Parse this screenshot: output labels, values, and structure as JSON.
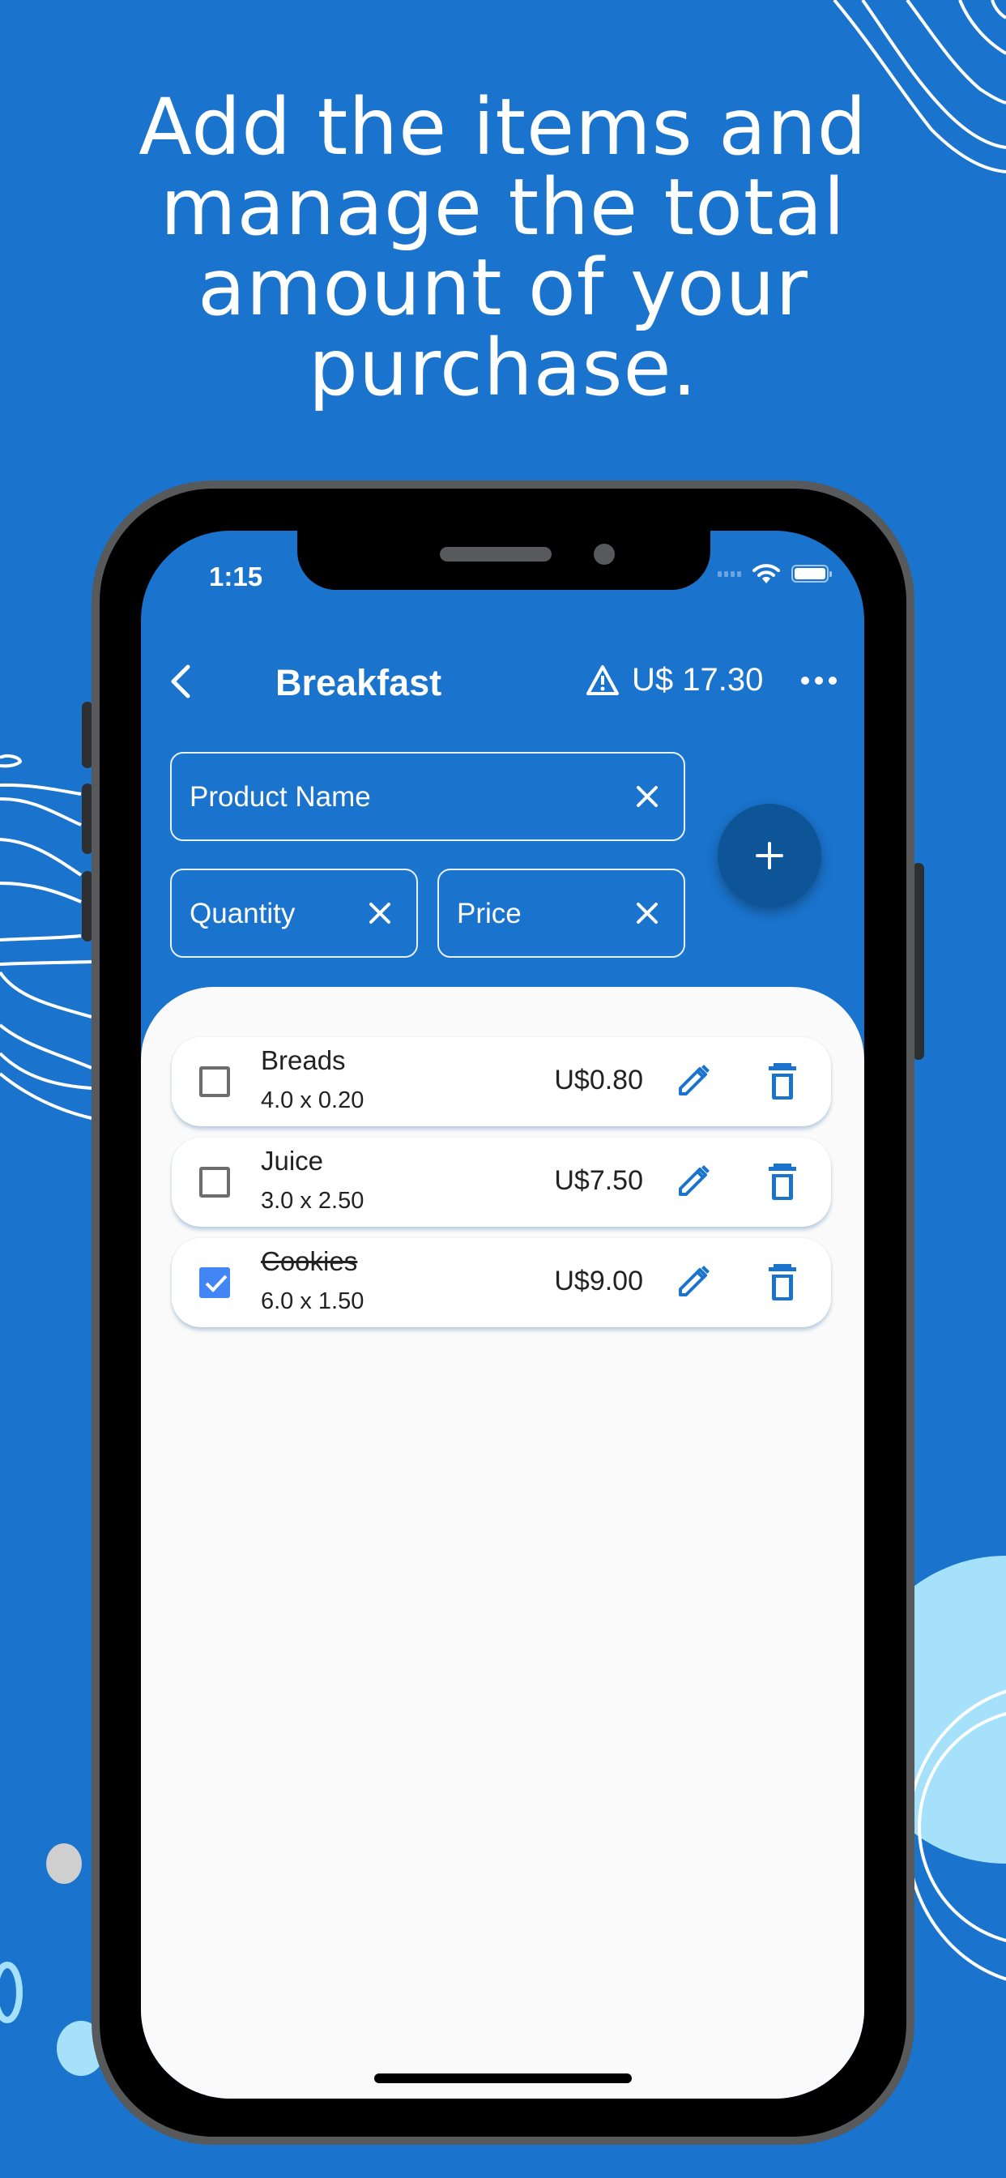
{
  "headline": {
    "lines": [
      "Add the items and",
      "manage the total",
      "amount of your",
      "purchase."
    ]
  },
  "status_bar": {
    "time": "1:15"
  },
  "app_bar": {
    "back_icon": "chevron-left-icon",
    "title": "Breakfast",
    "warning_icon": "warning-triangle-icon",
    "total": "U$ 17.30",
    "more_icon": "more-horizontal-icon"
  },
  "form": {
    "product_name": {
      "placeholder": "Product Name",
      "value": ""
    },
    "quantity": {
      "placeholder": "Quantity",
      "value": ""
    },
    "price": {
      "placeholder": "Price",
      "value": ""
    },
    "clear_icon": "close-icon",
    "add_icon": "plus-icon"
  },
  "items": [
    {
      "name": "Breads",
      "detail": "4.0 x 0.20",
      "total": "U$0.80",
      "checked": false
    },
    {
      "name": "Juice",
      "detail": "3.0 x 2.50",
      "total": "U$7.50",
      "checked": false
    },
    {
      "name": "Cookies",
      "detail": "6.0 x 1.50",
      "total": "U$9.00",
      "checked": true
    }
  ],
  "item_actions": {
    "edit_icon": "pencil-icon",
    "delete_icon": "trash-icon"
  },
  "colors": {
    "background": "#1a73cc",
    "fab": "#0e5598",
    "accent_icon": "#1a73cc",
    "checkbox_checked": "#4285f4",
    "deco_light_blue": "#a6e1fb"
  }
}
